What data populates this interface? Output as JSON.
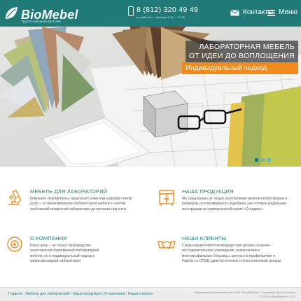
{
  "header": {
    "logo_text": "BioMebel",
    "logo_tagline": "Группа компаний БиоСайн",
    "phone": "8 (812) 320 49 49",
    "phone_hours": "по рабочим — пятница, 9:00 — 17:00",
    "contacts_label": "Контакты",
    "menu_label": "Меню"
  },
  "hero": {
    "title_line1": "ЛАБОРАТОРНАЯ МЕБЕЛЬ",
    "title_line2": "ОТ ИДЕИ ДО ВОПЛОЩЕНИЯ",
    "subtitle": "Индивидуальный подход",
    "slides_count": 3,
    "active_slide": 1
  },
  "features": [
    {
      "title": "МЕБЕЛЬ ДЛЯ ЛАБОРАТОРИЙ",
      "icon": "microscope-icon",
      "text": "Компания «БиоМебель» предлагает клиентам широкий спектр услуг – от проектирования лабораторной мебели с учетом требований конкретной лаборатории до монтажа под ключ."
    },
    {
      "title": "НАША ПРОДУКЦИЯ",
      "icon": "cabinet-icon",
      "text": "Мы предлагаем не только изготовление мебели любой формы и размеров, но и возможность подобрать уже готовые модульные конструкции из универсальной серии «Стандарт»."
    },
    {
      "title": "О КОМПАНИИ",
      "icon": "target-icon",
      "text": "Наша цель – не только производство качественной современной лабораторной мебели, но и индивидуальный подход к запросам каждой лаборатории"
    },
    {
      "title": "НАШИ КЛИЕНТЫ",
      "icon": "handshake-icon",
      "text": "Среди наших клиентов медицинские центры и научно-исследовательские учреждения, поликлиники и многопрофильные больницы, центры по профилактике и борьбе со СПИД, диагностические и онкологические центры."
    }
  ],
  "footer": {
    "nav": [
      "Главная",
      "Мебель для лабораторий",
      "Наша продукция",
      "О компании",
      "Наши клиенты"
    ],
    "info_line1": "Официальный представитель ООО «БиоМебель» – компания «БиоСистемы»",
    "info_line2": "© ООО «БиоМебель» 2017"
  },
  "colors": {
    "brand": "#1f7a78",
    "accent": "#f08a1c"
  }
}
